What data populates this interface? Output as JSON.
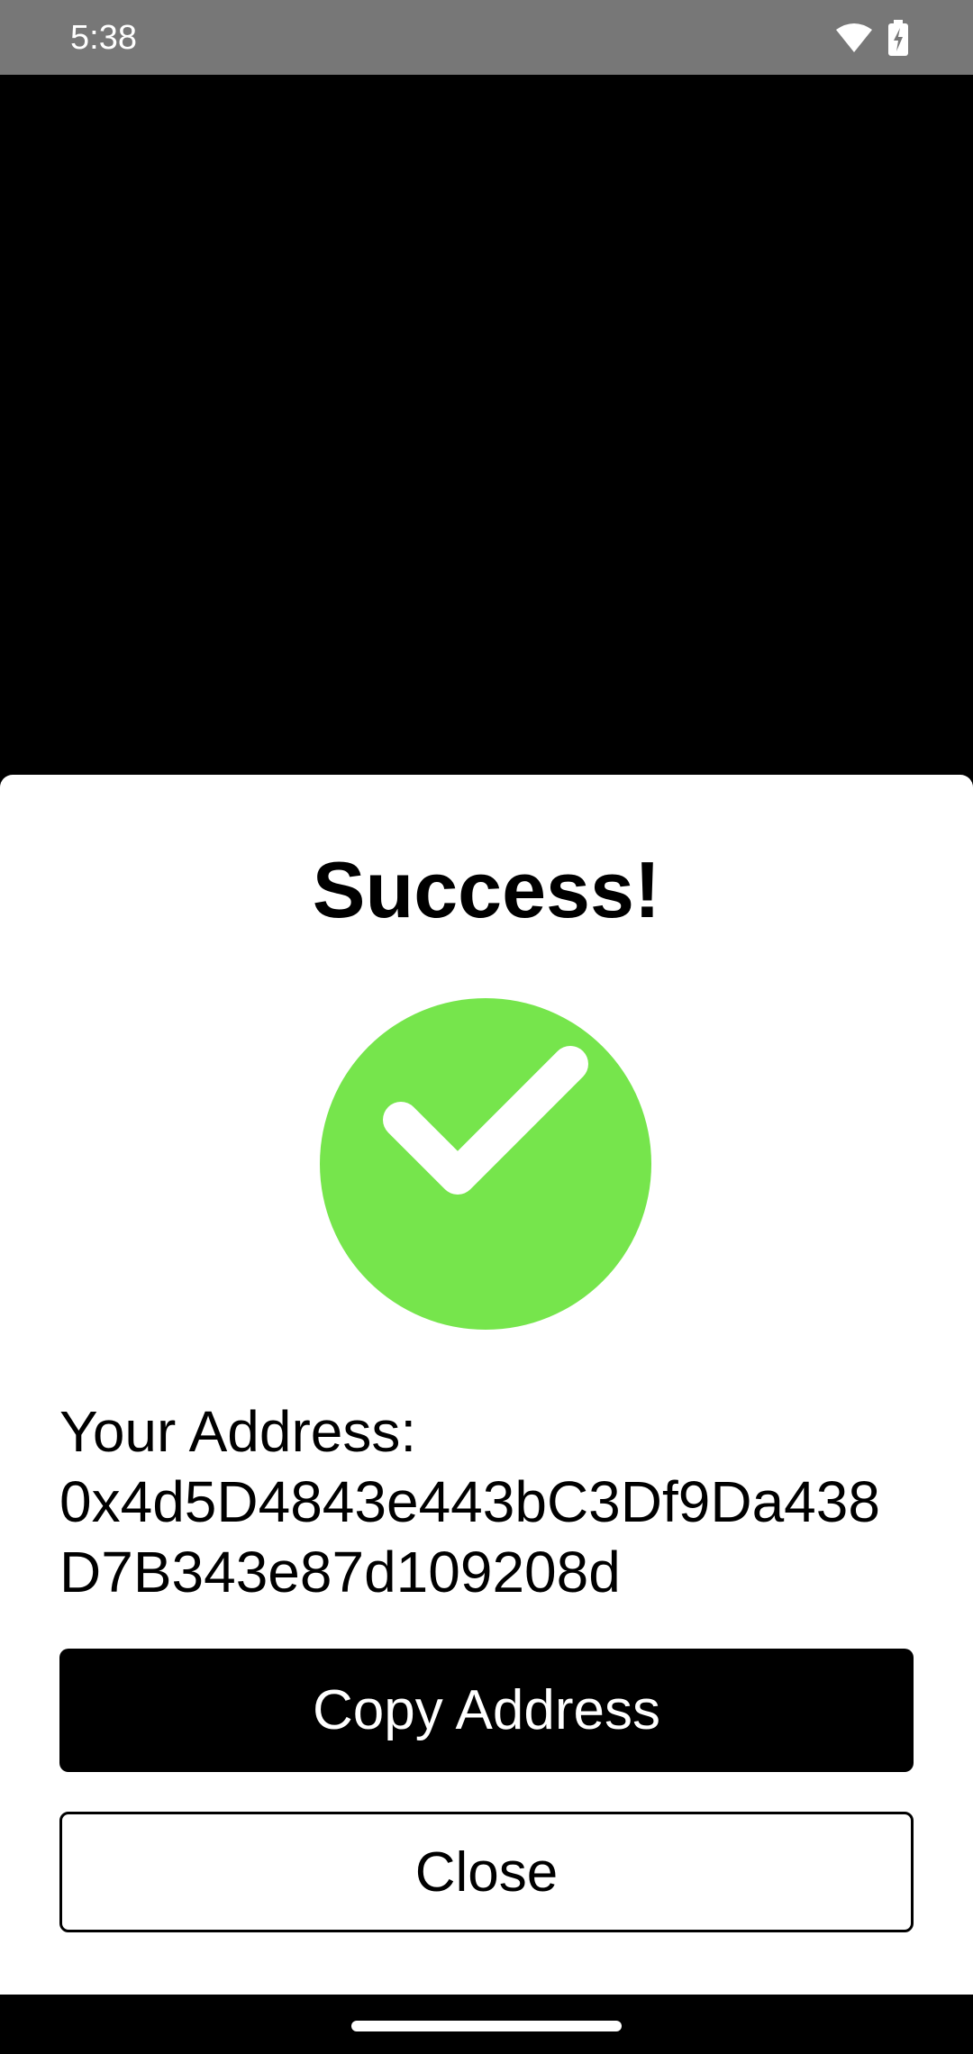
{
  "status_bar": {
    "time": "5:38",
    "icons": [
      "wifi-icon",
      "battery-charging-icon"
    ]
  },
  "dialog": {
    "title": "Success!",
    "icon": "check-circle-icon",
    "icon_color": "#76E54C",
    "address_label": "Your Address:",
    "address_line_1": "0x4d5D4843e443bC3Df9Da438",
    "address_line_2": "D7B343e87d109208d",
    "copy_button_label": "Copy Address",
    "close_button_label": "Close"
  },
  "colors": {
    "status_bar": "#777777",
    "backdrop": "#000000",
    "sheet": "#FFFFFF",
    "primary_button": "#000000"
  }
}
